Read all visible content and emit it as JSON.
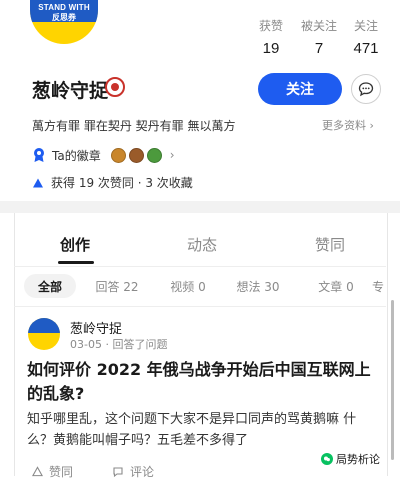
{
  "profile": {
    "avatar_text_top": "STAND WITH",
    "avatar_text_bottom": "反思券",
    "name": "葱岭守捉",
    "bio": "萬方有罪 罪在契丹 契丹有罪 無以萬方",
    "more_info": "更多资料 ›",
    "badges_label": "Ta的徽章",
    "likes_text": "获得 19 次赞同 · 3 次收藏"
  },
  "stats": [
    {
      "label": "获赞",
      "value": "19"
    },
    {
      "label": "被关注",
      "value": "7"
    },
    {
      "label": "关注",
      "value": "471"
    }
  ],
  "buttons": {
    "follow": "关注"
  },
  "tabs": [
    {
      "label": "创作",
      "active": true
    },
    {
      "label": "动态",
      "active": false
    },
    {
      "label": "赞同",
      "active": false
    }
  ],
  "filters": [
    {
      "label": "全部",
      "active": true
    },
    {
      "label": "回答 22",
      "active": false
    },
    {
      "label": "视频 0",
      "active": false
    },
    {
      "label": "想法 30",
      "active": false
    },
    {
      "label": "文章 0",
      "active": false
    },
    {
      "label": "专",
      "active": false
    }
  ],
  "post": {
    "author": "葱岭守捉",
    "meta": "03-05 · 回答了问题",
    "title": "如何评价 2022 年俄乌战争开始后中国互联网上的乱象?",
    "excerpt": "知乎哪里乱，这个问题下大家不是异口同声的骂黄鹅嘛 什么？黄鹅能叫帽子吗？五毛差不多得了",
    "actions": {
      "upvote": "赞同",
      "comment": "评论"
    }
  },
  "watermark": "局势析论",
  "colors": {
    "accent": "#1e5cf0",
    "avatar_blue": "#1f5bc4",
    "avatar_yellow": "#ffd400",
    "badge_red": "#c9322b"
  }
}
